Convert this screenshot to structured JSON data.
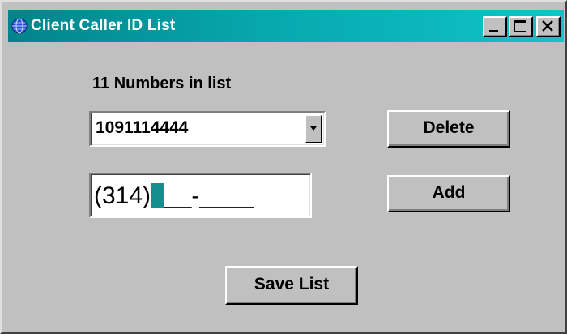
{
  "window": {
    "title": "Client Caller ID List",
    "icon": "globe-icon",
    "title_bar_color": "#06a7ad",
    "controls": {
      "minimize": "minimize-icon",
      "maximize": "maximize-icon",
      "close": "close-icon"
    }
  },
  "list": {
    "count_label": "11 Numbers in list",
    "selected_number": "1091114444",
    "dropdown_icon": "chevron-down-icon"
  },
  "entry": {
    "value": "(314)",
    "mask_after_cursor": "__-____",
    "cursor_color": "#138f8f"
  },
  "buttons": {
    "delete": "Delete",
    "add": "Add",
    "save": "Save List"
  }
}
